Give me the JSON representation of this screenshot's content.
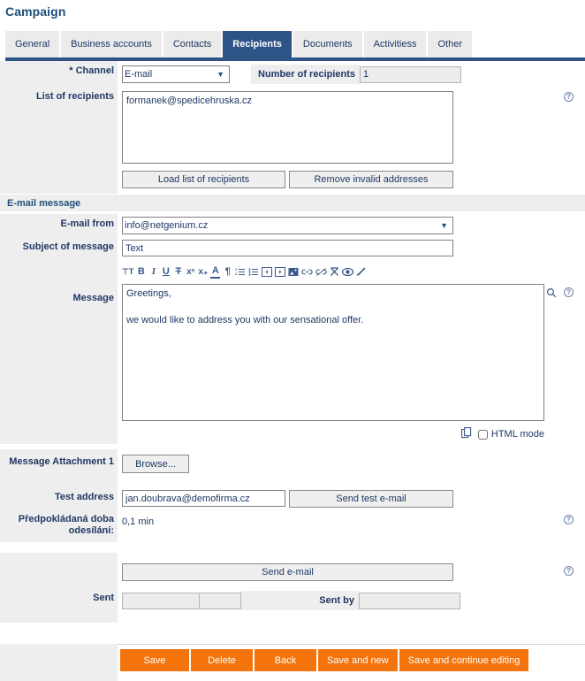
{
  "page": {
    "title": "Campaign"
  },
  "tabs": [
    {
      "label": "General",
      "active": false
    },
    {
      "label": "Business accounts",
      "active": false
    },
    {
      "label": "Contacts",
      "active": false
    },
    {
      "label": "Recipients",
      "active": true
    },
    {
      "label": "Documents",
      "active": false
    },
    {
      "label": "Activitiess",
      "active": false
    },
    {
      "label": "Other",
      "active": false
    }
  ],
  "recipients": {
    "channel_label": "* Channel",
    "channel_value": "E-mail",
    "channel_options": [
      "E-mail"
    ],
    "number_label": "Number of recipients",
    "number_value": "1",
    "list_label": "List of recipients",
    "list_value": "formanek@spedicehruska.cz",
    "load_button": "Load list of recipients",
    "remove_button": "Remove invalid addresses"
  },
  "email_message": {
    "section_title": "E-mail message",
    "from_label": "E-mail from",
    "from_value": "info@netgenium.cz",
    "from_options": [
      "info@netgenium.cz"
    ],
    "subject_label": "Subject of message",
    "subject_value": "Text",
    "message_label": "Message",
    "message_value": "Greetings,\n\nwe would like to address you with our sensational offer.",
    "html_mode_label": "HTML mode",
    "html_mode_checked": false,
    "toolbar_icons": [
      "font-size-icon",
      "bold-icon",
      "italic-icon",
      "underline-icon",
      "strikethrough-icon",
      "superscript-icon",
      "subscript-icon",
      "text-color-icon",
      "paragraph-icon",
      "ordered-list-icon",
      "unordered-list-icon",
      "outdent-icon",
      "indent-icon",
      "image-icon",
      "link-icon",
      "unlink-icon",
      "remove-format-icon",
      "preview-icon",
      "edit-pencil-icon"
    ]
  },
  "attachment": {
    "label": "Message Attachment 1",
    "browse_button": "Browse..."
  },
  "test": {
    "address_label": "Test address",
    "address_value": "jan.doubrava@demofirma.cz",
    "send_test_button": "Send test e-mail",
    "duration_label": "Předpokládaná doba odesílání:",
    "duration_value": "0,1 min"
  },
  "send": {
    "send_button": "Send e-mail",
    "sent_label": "Sent",
    "sent_date_value": "",
    "sent_time_value": "",
    "sent_by_label": "Sent by",
    "sent_by_value": ""
  },
  "actions": [
    {
      "label": "Save"
    },
    {
      "label": "Delete"
    },
    {
      "label": "Back"
    },
    {
      "label": "Save and new"
    },
    {
      "label": "Save and continue editing"
    }
  ],
  "icons": {
    "help": "?",
    "search": "search-icon",
    "copy": "copy-icon",
    "chevron": "▼"
  },
  "colors": {
    "accent_blue": "#2e5386",
    "title_blue": "#1f4e79",
    "action_orange": "#f4740b",
    "label_grey": "#eeeeee"
  }
}
